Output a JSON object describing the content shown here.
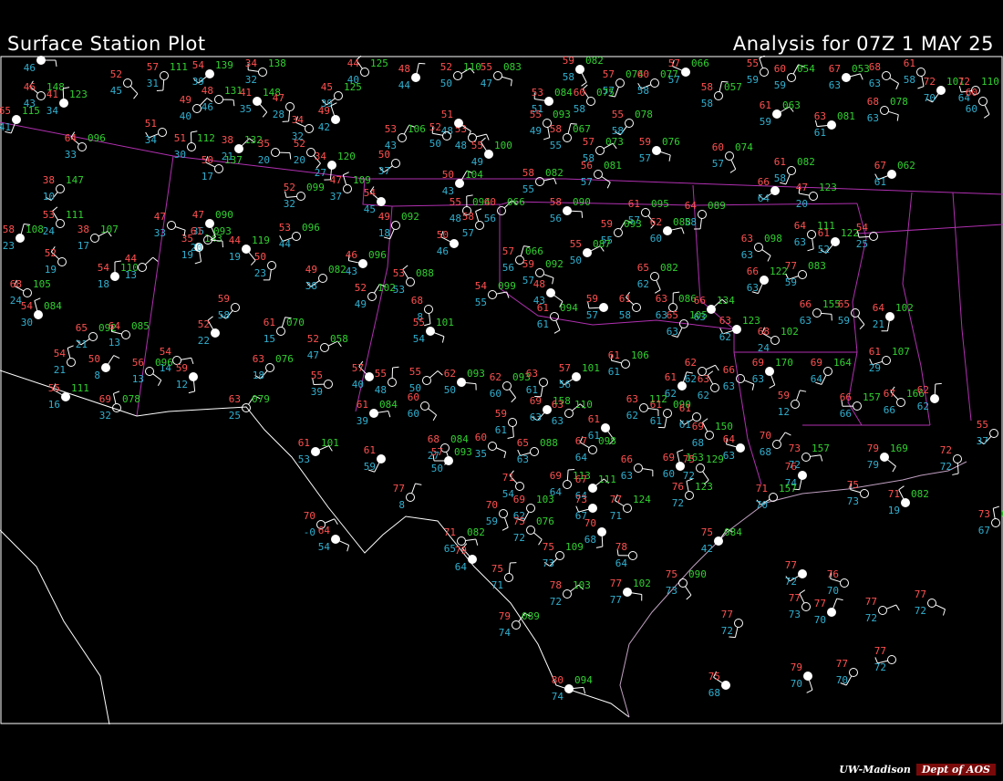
{
  "header": {
    "left_title": "Surface Station Plot",
    "right_title": "Analysis for 07Z  1 MAY 25"
  },
  "footer": {
    "institution": "UW-Madison",
    "department": "Dept of AOS"
  },
  "colors": {
    "background": "#000000",
    "temperature": "#ff5050",
    "dewpoint": "#30b0d0",
    "pressure": "#30d030",
    "state_boundary": "#b030b0",
    "border": "#ffffff",
    "coast": "#c0a0c0",
    "symbol": "#ffffff"
  },
  "stations": [
    {
      "t": "47",
      "td": "46",
      "p": "147"
    },
    {
      "t": "52",
      "td": "45"
    },
    {
      "t": "57",
      "td": "31",
      "p": "111"
    },
    {
      "t": "54",
      "td": "39",
      "p": "139"
    },
    {
      "t": "34",
      "td": "32",
      "p": "138"
    },
    {
      "t": "44",
      "td": "40",
      "p": "125"
    },
    {
      "t": "48",
      "td": "44"
    },
    {
      "t": "52",
      "td": "50",
      "p": "110"
    },
    {
      "t": "55",
      "td": "47",
      "p": "083"
    },
    {
      "t": "59",
      "td": "58",
      "p": "082"
    },
    {
      "t": "57",
      "td": "57",
      "p": "074"
    },
    {
      "t": "60",
      "td": "58",
      "p": "077"
    },
    {
      "t": "57",
      "td": "57",
      "p": "066"
    },
    {
      "t": "55",
      "td": "59"
    },
    {
      "t": "60",
      "td": "59",
      "p": "054"
    },
    {
      "t": "67",
      "td": "63",
      "p": "053"
    },
    {
      "t": "68",
      "td": "63"
    },
    {
      "t": "61",
      "td": "58"
    },
    {
      "t": "72",
      "td": "70",
      "p": "101"
    },
    {
      "t": "72",
      "td": "64",
      "p": "110"
    },
    {
      "t": "46",
      "td": "43",
      "p": "148"
    },
    {
      "t": "41",
      "td": "34",
      "p": "123"
    },
    {
      "t": "49",
      "td": "40"
    },
    {
      "t": "48",
      "td": "46",
      "p": "131"
    },
    {
      "t": "41",
      "td": "35",
      "p": "148"
    },
    {
      "t": "47",
      "td": "28"
    },
    {
      "t": "45",
      "td": "39",
      "p": "125"
    },
    {
      "t": "53",
      "td": "51",
      "p": "084"
    },
    {
      "t": "60",
      "td": "58",
      "p": "075"
    },
    {
      "t": "58",
      "td": "58",
      "p": "057"
    },
    {
      "t": "61",
      "td": "59",
      "p": "063"
    },
    {
      "t": "68",
      "td": "63",
      "p": "078"
    },
    {
      "t": "60",
      "td": "60"
    },
    {
      "t": "65",
      "td": "41",
      "p": "115"
    },
    {
      "t": "51",
      "td": "34"
    },
    {
      "t": "34",
      "td": "32"
    },
    {
      "t": "49",
      "td": "42"
    },
    {
      "t": "53",
      "td": "43",
      "p": "106"
    },
    {
      "t": "53",
      "td": "48"
    },
    {
      "t": "51",
      "td": "48"
    },
    {
      "t": "55",
      "td": "49",
      "p": "093"
    },
    {
      "t": "55",
      "td": "58",
      "p": "078"
    },
    {
      "t": "63",
      "td": "61",
      "p": "081"
    },
    {
      "t": "64",
      "td": "33",
      "p": "096"
    },
    {
      "t": "51",
      "td": "30",
      "p": "112"
    },
    {
      "t": "38",
      "td": "21",
      "p": "132"
    },
    {
      "t": "35",
      "td": "20"
    },
    {
      "t": "52",
      "td": "20"
    },
    {
      "t": "34",
      "td": "27",
      "p": "120"
    },
    {
      "t": "50",
      "td": "37"
    },
    {
      "t": "52",
      "td": "50"
    },
    {
      "t": "55",
      "td": "49",
      "p": "100"
    },
    {
      "t": "58",
      "td": "55",
      "p": "067"
    },
    {
      "t": "57",
      "td": "58",
      "p": "073"
    },
    {
      "t": "59",
      "td": "57",
      "p": "076"
    },
    {
      "t": "60",
      "td": "57",
      "p": "074"
    },
    {
      "t": "61",
      "td": "58",
      "p": "082"
    },
    {
      "t": "67",
      "td": "61",
      "p": "062"
    },
    {
      "t": "50",
      "td": "17",
      "p": "137"
    },
    {
      "t": "47",
      "td": "37",
      "p": "109"
    },
    {
      "t": "50",
      "td": "43",
      "p": "104"
    },
    {
      "t": "58",
      "td": "55",
      "p": "082"
    },
    {
      "t": "56",
      "td": "57",
      "p": "081"
    },
    {
      "t": "35",
      "td": "19",
      "p": "143"
    },
    {
      "t": "38",
      "td": "10",
      "p": "147"
    },
    {
      "t": "52",
      "td": "32",
      "p": "099"
    },
    {
      "t": "54",
      "td": "45"
    },
    {
      "t": "55",
      "td": "48",
      "p": "094"
    },
    {
      "t": "60",
      "td": "56",
      "p": "066"
    },
    {
      "t": "58",
      "td": "56",
      "p": "090"
    },
    {
      "t": "61",
      "td": "57",
      "p": "095"
    },
    {
      "t": "64",
      "td": "58",
      "p": "089"
    },
    {
      "t": "66",
      "td": "64"
    },
    {
      "t": "47",
      "td": "20",
      "p": "123"
    },
    {
      "t": "53",
      "td": "24",
      "p": "111"
    },
    {
      "t": "58",
      "td": "23",
      "p": "108"
    },
    {
      "t": "38",
      "td": "17",
      "p": "107"
    },
    {
      "t": "47",
      "td": "33"
    },
    {
      "t": "47",
      "td": "35",
      "p": "090"
    },
    {
      "t": "49",
      "td": "18",
      "p": "092"
    },
    {
      "t": "53",
      "td": "44",
      "p": "096"
    },
    {
      "t": "50",
      "td": "46"
    },
    {
      "t": "58",
      "td": "57"
    },
    {
      "t": "59",
      "td": "55",
      "p": "093"
    },
    {
      "t": "62",
      "td": "60",
      "p": "088"
    },
    {
      "t": "63",
      "td": "63",
      "p": "098"
    },
    {
      "t": "64",
      "td": "63",
      "p": "111"
    },
    {
      "t": "61",
      "td": "52",
      "p": "122"
    },
    {
      "t": "54",
      "td": "25"
    },
    {
      "t": "52",
      "td": "19"
    },
    {
      "t": "54",
      "td": "18",
      "p": "110"
    },
    {
      "t": "44",
      "td": "13"
    },
    {
      "t": "61",
      "td": "20",
      "p": "093"
    },
    {
      "t": "44",
      "td": "19",
      "p": "119"
    },
    {
      "t": "50",
      "td": "23"
    },
    {
      "t": "49",
      "td": "38",
      "p": "082"
    },
    {
      "t": "46",
      "td": "43",
      "p": "096"
    },
    {
      "t": "53",
      "td": "53",
      "p": "088"
    },
    {
      "t": "57",
      "td": "56",
      "p": "066"
    },
    {
      "t": "55",
      "td": "50",
      "p": "087"
    },
    {
      "t": "59",
      "td": "57",
      "p": "092"
    },
    {
      "t": "65",
      "td": "62",
      "p": "082"
    },
    {
      "t": "66",
      "td": "63",
      "p": "122"
    },
    {
      "t": "77",
      "td": "59",
      "p": "083"
    },
    {
      "t": "68",
      "td": "24",
      "p": "105"
    },
    {
      "t": "54",
      "td": "30",
      "p": "084"
    },
    {
      "t": "52",
      "td": "49",
      "p": "102"
    },
    {
      "t": "54",
      "td": "55",
      "p": "099"
    },
    {
      "t": "48",
      "td": "43"
    },
    {
      "t": "68",
      "td": "8"
    },
    {
      "t": "59",
      "td": "58"
    },
    {
      "t": "59",
      "td": "57"
    },
    {
      "t": "61",
      "td": "58"
    },
    {
      "t": "63",
      "td": "63",
      "p": "086"
    },
    {
      "t": "66",
      "td": "63",
      "p": "134"
    },
    {
      "t": "66",
      "td": "63",
      "p": "155"
    },
    {
      "t": "65",
      "td": "59"
    },
    {
      "t": "64",
      "td": "21",
      "p": "102"
    },
    {
      "t": "65",
      "td": "21",
      "p": "092"
    },
    {
      "t": "64",
      "td": "13",
      "p": "085"
    },
    {
      "t": "52",
      "td": "22"
    },
    {
      "t": "61",
      "td": "15",
      "p": "070"
    },
    {
      "t": "52",
      "td": "47",
      "p": "058"
    },
    {
      "t": "55",
      "td": "54",
      "p": "101"
    },
    {
      "t": "61",
      "td": "61",
      "p": "094"
    },
    {
      "t": "65",
      "td": "63",
      "p": "105"
    },
    {
      "t": "63",
      "td": "62",
      "p": "123"
    },
    {
      "t": "68",
      "td": "24",
      "p": "102"
    },
    {
      "t": "54",
      "td": "21"
    },
    {
      "t": "50",
      "td": "8"
    },
    {
      "t": "54",
      "td": "14"
    },
    {
      "t": "56",
      "td": "13",
      "p": "096"
    },
    {
      "t": "59",
      "td": "12"
    },
    {
      "t": "63",
      "td": "18",
      "p": "076"
    },
    {
      "t": "55",
      "td": "39"
    },
    {
      "t": "57",
      "td": "40"
    },
    {
      "t": "55",
      "td": "48"
    },
    {
      "t": "55",
      "td": "50"
    },
    {
      "t": "62",
      "td": "50",
      "p": "093"
    },
    {
      "t": "62",
      "td": "60",
      "p": "093"
    },
    {
      "t": "63",
      "td": "61"
    },
    {
      "t": "57",
      "td": "56",
      "p": "101"
    },
    {
      "t": "61",
      "td": "61",
      "p": "106"
    },
    {
      "t": "63",
      "td": "62"
    },
    {
      "t": "61",
      "td": "62"
    },
    {
      "t": "62",
      "td": "62"
    },
    {
      "t": "66",
      "td": "63"
    },
    {
      "t": "69",
      "td": "63",
      "p": "170"
    },
    {
      "t": "69",
      "td": "64",
      "p": "164"
    },
    {
      "t": "61",
      "td": "29",
      "p": "107"
    },
    {
      "t": "55",
      "td": "16",
      "p": "111"
    },
    {
      "t": "69",
      "td": "32",
      "p": "078"
    },
    {
      "t": "63",
      "td": "25",
      "p": "079"
    },
    {
      "t": "61",
      "td": "39",
      "p": "084"
    },
    {
      "t": "60",
      "td": "60"
    },
    {
      "t": "59",
      "td": "61"
    },
    {
      "t": "69",
      "td": "63",
      "p": "158"
    },
    {
      "t": "66",
      "td": "66",
      "p": "157"
    },
    {
      "t": "67",
      "td": "66",
      "p": "166"
    },
    {
      "t": "62",
      "td": "62"
    },
    {
      "t": "63",
      "td": "63",
      "p": "110"
    },
    {
      "t": "63",
      "td": "62",
      "p": "112"
    },
    {
      "t": "61",
      "td": "61"
    },
    {
      "t": "61",
      "td": "61",
      "p": "090"
    },
    {
      "t": "61",
      "td": "61"
    },
    {
      "t": "64",
      "td": "63"
    },
    {
      "t": "69",
      "td": "68",
      "p": "150"
    },
    {
      "t": "59",
      "td": "12"
    },
    {
      "t": "61",
      "td": "53",
      "p": "101"
    },
    {
      "t": "60",
      "td": "35"
    },
    {
      "t": "68",
      "td": "27",
      "p": "084"
    },
    {
      "t": "61",
      "td": "59"
    },
    {
      "t": "65",
      "td": "63",
      "p": "088"
    },
    {
      "t": "67",
      "td": "64",
      "p": "098"
    },
    {
      "t": "69",
      "td": "60",
      "p": "163"
    },
    {
      "t": "70",
      "td": "68"
    },
    {
      "t": "73",
      "td": "72",
      "p": "157"
    },
    {
      "t": "79",
      "td": "79",
      "p": "169"
    },
    {
      "t": "72",
      "td": "72"
    },
    {
      "t": "55",
      "td": "37"
    },
    {
      "t": "57",
      "td": "50",
      "p": "093"
    },
    {
      "t": "71",
      "td": "54"
    },
    {
      "t": "69",
      "td": "64",
      "p": "113"
    },
    {
      "t": "67",
      "td": "64",
      "p": "111"
    },
    {
      "t": "66",
      "td": "63"
    },
    {
      "t": "75",
      "td": "72",
      "p": "129"
    },
    {
      "t": "76",
      "td": "74"
    },
    {
      "t": "71",
      "td": "70",
      "p": "157"
    },
    {
      "t": "75",
      "td": "73"
    },
    {
      "t": "71",
      "td": "19",
      "p": "082"
    },
    {
      "t": "77",
      "td": "8"
    },
    {
      "t": "70",
      "td": "-0"
    },
    {
      "t": "64",
      "td": "54"
    },
    {
      "t": "70",
      "td": "59"
    },
    {
      "t": "69",
      "td": "62",
      "p": "103"
    },
    {
      "t": "73",
      "td": "67"
    },
    {
      "t": "77",
      "td": "71",
      "p": "124"
    },
    {
      "t": "76",
      "td": "72",
      "p": "123"
    },
    {
      "t": "75",
      "td": "42",
      "p": "084"
    },
    {
      "t": "71",
      "td": "65",
      "p": "082"
    },
    {
      "t": "75",
      "td": "72",
      "p": "076"
    },
    {
      "t": "70",
      "td": "68"
    },
    {
      "t": "75",
      "td": "73",
      "p": "109"
    },
    {
      "t": "78",
      "td": "64"
    },
    {
      "t": "79",
      "td": "64"
    },
    {
      "t": "75",
      "td": "71"
    },
    {
      "t": "78",
      "td": "72",
      "p": "103"
    },
    {
      "t": "77",
      "td": "77",
      "p": "102"
    },
    {
      "t": "75",
      "td": "73",
      "p": "090"
    },
    {
      "t": "77",
      "td": "72"
    },
    {
      "t": "77",
      "td": "72"
    },
    {
      "t": "76",
      "td": "70"
    },
    {
      "t": "77",
      "td": "73"
    },
    {
      "t": "77",
      "td": "70"
    },
    {
      "t": "77",
      "td": "72"
    },
    {
      "t": "77",
      "td": "72"
    },
    {
      "t": "79",
      "td": "70"
    },
    {
      "t": "77",
      "td": "70"
    },
    {
      "t": "77",
      "td": "72"
    },
    {
      "t": "75",
      "td": "68"
    },
    {
      "t": "73",
      "td": "67",
      "p": "081"
    },
    {
      "t": "79",
      "td": "74",
      "p": "089"
    },
    {
      "t": "80",
      "td": "74",
      "p": "094"
    }
  ]
}
